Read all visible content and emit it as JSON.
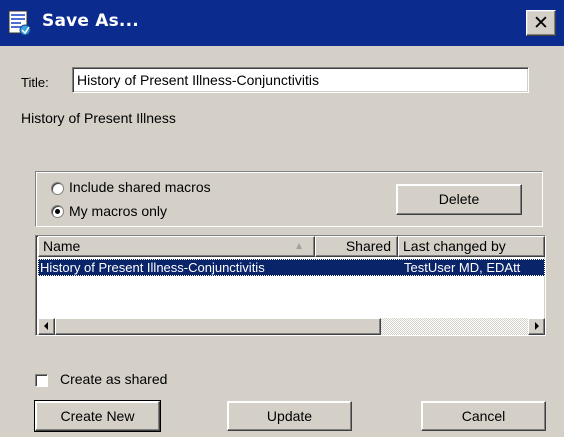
{
  "window": {
    "title": "Save As...",
    "close_glyph": "✕"
  },
  "form": {
    "title_label": "Title:",
    "title_value": "History of Present Illness-Conjunctivitis",
    "category_text": "History of Present Illness"
  },
  "filter": {
    "include_shared_label": "Include shared macros",
    "my_macros_label": "My macros only",
    "selected": "my_macros_only",
    "delete_label": "Delete"
  },
  "table": {
    "columns": [
      "Name",
      "Shared",
      "Last changed by"
    ],
    "sort_indicator": "▲",
    "rows": [
      {
        "name": "History of Present Illness-Conjunctivitis",
        "shared": "",
        "last_changed_by": "TestUser MD, EDAtt",
        "selected": true
      }
    ]
  },
  "options": {
    "create_as_shared_label": "Create as shared",
    "create_as_shared_checked": false
  },
  "buttons": {
    "create_new": "Create New",
    "update": "Update",
    "cancel": "Cancel"
  },
  "icons": {
    "app": "document-save-icon",
    "close": "close-icon",
    "scroll_left": "arrow-left-icon",
    "scroll_right": "arrow-right-icon"
  }
}
